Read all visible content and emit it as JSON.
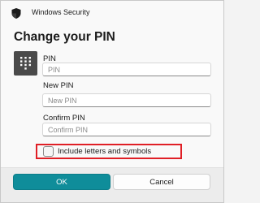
{
  "window": {
    "title": "Windows Security"
  },
  "dialog": {
    "heading": "Change your PIN",
    "icon": "keypad-icon",
    "fields": {
      "pin": {
        "label": "PIN",
        "placeholder": "PIN",
        "value": ""
      },
      "new_pin": {
        "label": "New PIN",
        "placeholder": "New PIN",
        "value": ""
      },
      "confirm_pin": {
        "label": "Confirm PIN",
        "placeholder": "Confirm PIN",
        "value": ""
      }
    },
    "checkbox": {
      "label": "Include letters and symbols",
      "checked": false
    }
  },
  "buttons": {
    "ok": "OK",
    "cancel": "Cancel"
  },
  "colors": {
    "accent": "#0f8d9a",
    "highlight": "#e01f26",
    "icon_bg": "#4a4a4a"
  }
}
